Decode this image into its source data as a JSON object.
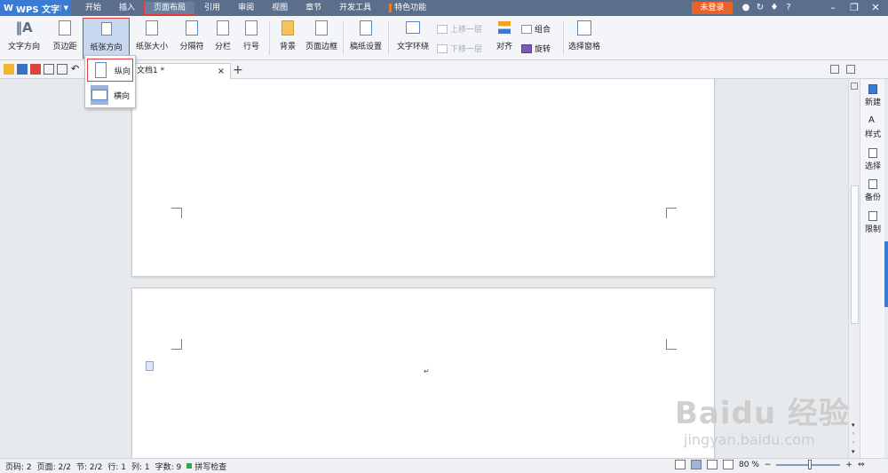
{
  "app": {
    "logo_text": "WPS 文字",
    "login_label": "未登录"
  },
  "menu": {
    "tabs": [
      "开始",
      "插入",
      "页面布局",
      "引用",
      "审阅",
      "视图",
      "章节",
      "开发工具",
      "特色功能"
    ],
    "active_tab": "页面布局"
  },
  "ribbon": {
    "text_direction": "文字方向",
    "margins": "页边距",
    "orientation": "纸张方向",
    "paper_size": "纸张大小",
    "breaks": "分隔符",
    "columns": "分栏",
    "line_numbers": "行号",
    "background": "背景",
    "page_border": "页面边框",
    "grid_paper": "稿纸设置",
    "text_wrap": "文字环绕",
    "bring_forward": "上移一层",
    "send_backward": "下移一层",
    "align": "对齐",
    "group": "组合",
    "rotate": "旋转",
    "selection_pane": "选择窗格"
  },
  "document_tab": {
    "name": "文档1 *",
    "close": "×",
    "new_tab": "+"
  },
  "orientation_menu": {
    "portrait": "纵向",
    "landscape": "横向"
  },
  "right_panel": {
    "items": [
      "新建",
      "样式",
      "选择",
      "备份",
      "限制"
    ]
  },
  "status": {
    "page_number": "页码: 2",
    "pages": "页面: 2/2",
    "section": "节: 2/2",
    "row": "行: 1",
    "column": "列: 1",
    "word_count": "字数: 9",
    "spell_check": "拼写检查",
    "zoom": "80 %",
    "zoom_minus": "−",
    "zoom_plus": "+"
  },
  "watermark": {
    "main": "Baidu 经验",
    "sub": "jingyan.baidu.com"
  },
  "colors": {
    "menubar": "#5b6f8c",
    "accent": "#3a7bd5",
    "login": "#e8632b",
    "highlight": "#e03a3a"
  }
}
